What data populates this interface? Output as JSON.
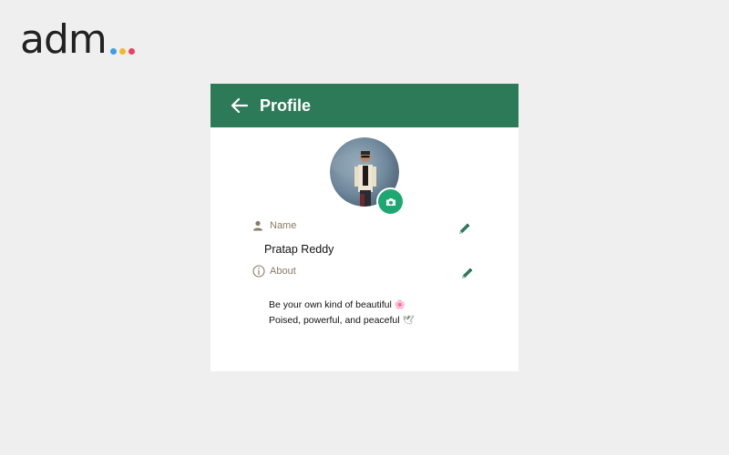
{
  "logo": {
    "text": "adm",
    "dot_colors": [
      "#3b9ee8",
      "#f2b72a",
      "#e7426a"
    ]
  },
  "header": {
    "title": "Profile",
    "background": "#2d7a59",
    "back_icon": "arrow-left-icon"
  },
  "avatar": {
    "camera_icon": "camera-icon",
    "camera_color": "#1ea871"
  },
  "name_field": {
    "label": "Name",
    "value": "Pratap Reddy",
    "icon": "person-icon",
    "edit_icon": "pencil-icon"
  },
  "about_field": {
    "label": "About",
    "lines": [
      {
        "text": "Be your own kind of beautiful",
        "emoji": "🌸"
      },
      {
        "text": "Poised, powerful, and peaceful",
        "emoji": "🕊"
      }
    ],
    "icon": "info-icon",
    "edit_icon": "pencil-icon"
  }
}
